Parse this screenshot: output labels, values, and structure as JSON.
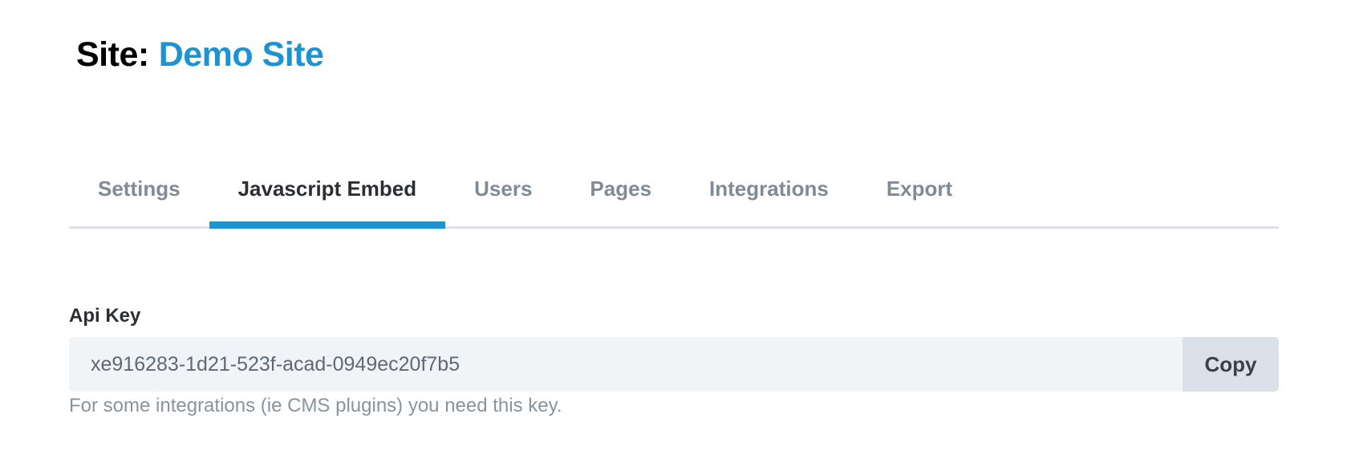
{
  "header": {
    "prefix": "Site:",
    "site_name": "Demo Site"
  },
  "tabs": [
    {
      "label": "Settings",
      "active": false
    },
    {
      "label": "Javascript Embed",
      "active": true
    },
    {
      "label": "Users",
      "active": false
    },
    {
      "label": "Pages",
      "active": false
    },
    {
      "label": "Integrations",
      "active": false
    },
    {
      "label": "Export",
      "active": false
    }
  ],
  "api_key": {
    "label": "Api Key",
    "value": "xe916283-1d21-523f-acad-0949ec20f7b5",
    "copy_label": "Copy",
    "help": "For some integrations (ie CMS plugins) you need this key."
  },
  "colors": {
    "accent": "#1e93d1"
  }
}
